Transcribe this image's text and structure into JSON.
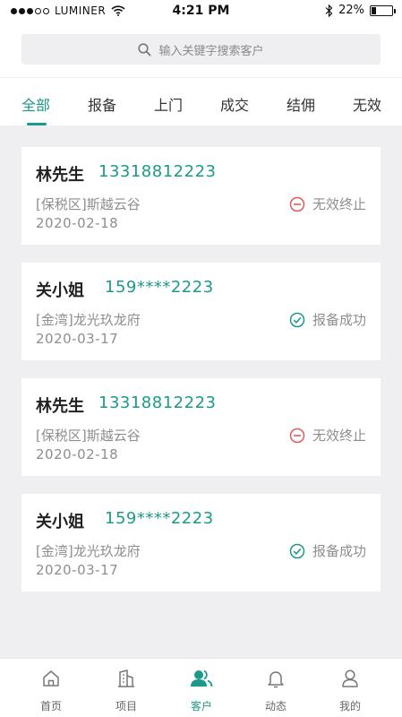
{
  "statusbar": {
    "carrier": "LUMINER",
    "time": "4:21 PM",
    "battery": "22%",
    "battery_level": 0.22
  },
  "search": {
    "placeholder": "输入关键字搜索客户"
  },
  "tabs": [
    {
      "label": "全部",
      "active": true
    },
    {
      "label": "报备",
      "active": false
    },
    {
      "label": "上门",
      "active": false
    },
    {
      "label": "成交",
      "active": false
    },
    {
      "label": "结佣",
      "active": false
    },
    {
      "label": "无效",
      "active": false
    }
  ],
  "customers": [
    {
      "name": "林先生",
      "phone": "13318812223",
      "project": "[保税区]斯越云谷",
      "date": "2020-02-18",
      "status": "无效终止",
      "status_icon": "minus-circle-icon",
      "status_color": "#e05a5a"
    },
    {
      "name": "关小姐",
      "phone": "159****2223",
      "project": "[金湾]龙光玖龙府",
      "date": "2020-03-17",
      "status": "报备成功",
      "status_icon": "check-circle-icon",
      "status_color": "#1b9a8a"
    },
    {
      "name": "林先生",
      "phone": "13318812223",
      "project": "[保税区]斯越云谷",
      "date": "2020-02-18",
      "status": "无效终止",
      "status_icon": "minus-circle-icon",
      "status_color": "#e05a5a"
    },
    {
      "name": "关小姐",
      "phone": "159****2223",
      "project": "[金湾]龙光玖龙府",
      "date": "2020-03-17",
      "status": "报备成功",
      "status_icon": "check-circle-icon",
      "status_color": "#1b9a8a"
    }
  ],
  "bottomnav": [
    {
      "label": "首页",
      "icon": "home-icon",
      "active": false
    },
    {
      "label": "项目",
      "icon": "building-icon",
      "active": false
    },
    {
      "label": "客户",
      "icon": "users-icon",
      "active": true
    },
    {
      "label": "动态",
      "icon": "bell-icon",
      "active": false
    },
    {
      "label": "我的",
      "icon": "user-icon",
      "active": false
    }
  ],
  "colors": {
    "accent": "#1b9a8a",
    "invalid": "#e05a5a",
    "background": "#efeff1"
  }
}
